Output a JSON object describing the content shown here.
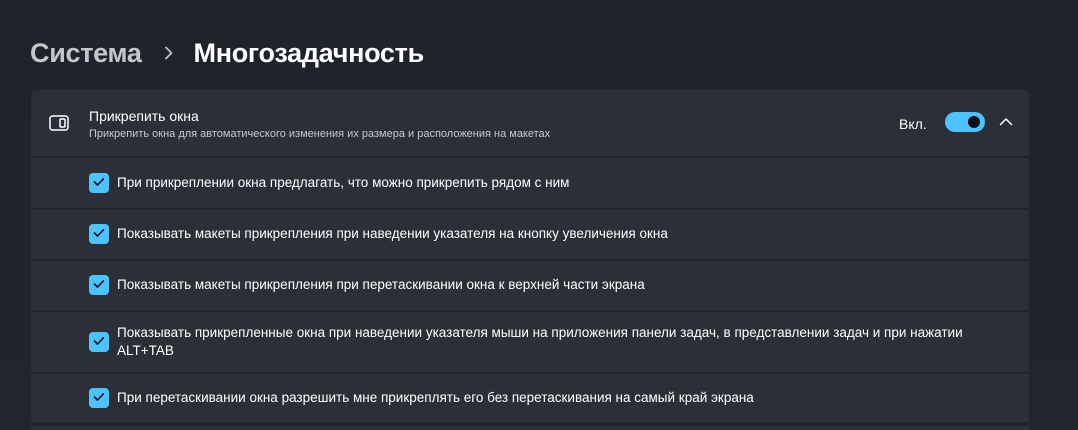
{
  "breadcrumb": {
    "parent": "Система",
    "separator_icon": "chevron-right-icon",
    "current": "Многозадачность"
  },
  "snap_section": {
    "icon": "snap-window-icon",
    "title": "Прикрепить окна",
    "description": "Прикрепить окна для автоматического изменения их размера и расположения на макетах",
    "state_label": "Вкл.",
    "toggle_on": true,
    "collapse_icon": "chevron-up-icon",
    "accent_color": "#4cc2ff"
  },
  "options": [
    {
      "label": "При прикреплении окна предлагать, что можно прикрепить рядом с ним",
      "checked": true
    },
    {
      "label": "Показывать макеты прикрепления при наведении указателя на кнопку увеличения окна",
      "checked": true
    },
    {
      "label": "Показывать макеты прикрепления при перетаскивании окна к верхней части экрана",
      "checked": true
    },
    {
      "label": "Показывать прикрепленные окна при наведении указателя мыши на приложения панели задач, в представлении задач и при нажатии ALT+TAB",
      "checked": true
    },
    {
      "label": "При перетаскивании окна разрешить мне прикреплять его без перетаскивания на самый край экрана",
      "checked": true
    }
  ]
}
